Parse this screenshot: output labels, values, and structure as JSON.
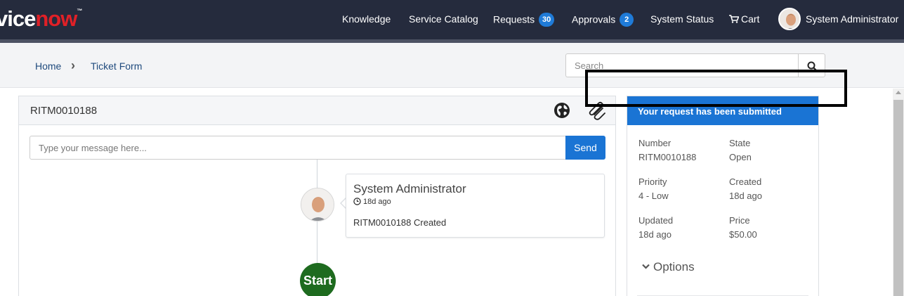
{
  "nav": {
    "logo_main": "vice",
    "logo_accent": "now",
    "logo_tm": "™",
    "items": [
      {
        "label": "Knowledge"
      },
      {
        "label": "Service Catalog"
      },
      {
        "label": "Requests",
        "badge": "30"
      },
      {
        "label": "Approvals",
        "badge": "2"
      },
      {
        "label": "System Status"
      },
      {
        "label": "Cart"
      }
    ],
    "user_name": "System Administrator"
  },
  "breadcrumb": {
    "items": [
      "Home",
      "Ticket Form"
    ],
    "separator": "›"
  },
  "search": {
    "placeholder": "Search"
  },
  "ticket": {
    "number": "RITM0010188",
    "message_placeholder": "Type your message here...",
    "send_label": "Send",
    "entries": [
      {
        "author": "System Administrator",
        "time": "18d ago",
        "text": "RITM0010188 Created"
      }
    ],
    "start_label": "Start"
  },
  "summary": {
    "header": "Your request has been submitted",
    "fields": [
      {
        "label": "Number",
        "value": "RITM0010188"
      },
      {
        "label": "State",
        "value": "Open"
      },
      {
        "label": "Priority",
        "value": "4 - Low"
      },
      {
        "label": "Created",
        "value": "18d ago"
      },
      {
        "label": "Updated",
        "value": "18d ago"
      },
      {
        "label": "Price",
        "value": "$50.00"
      }
    ],
    "options_label": "Options"
  },
  "colors": {
    "navbar": "#252b3d",
    "brand_accent": "#e02027",
    "primary": "#1a74d4",
    "start_node": "#1e6b1f"
  }
}
